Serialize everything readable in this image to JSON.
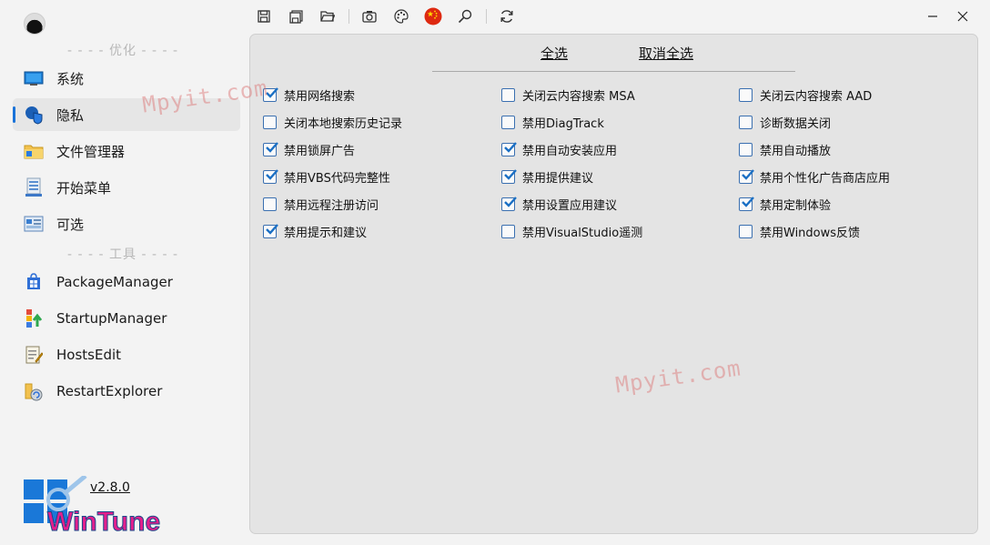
{
  "sidebar": {
    "section_optimize": "- - - - 优化 - - - -",
    "section_tools": "- - - - 工具 - - - -",
    "optimize_items": [
      {
        "label": "系统"
      },
      {
        "label": "隐私"
      },
      {
        "label": "文件管理器"
      },
      {
        "label": "开始菜单"
      },
      {
        "label": "可选"
      }
    ],
    "tool_items": [
      {
        "label": "PackageManager"
      },
      {
        "label": "StartupManager"
      },
      {
        "label": "HostsEdit"
      },
      {
        "label": "RestartExplorer"
      }
    ],
    "version": "v2.8.0",
    "logo_text": "WinTune"
  },
  "toolbar": {
    "icons": [
      "save-icon",
      "save-all-icon",
      "open-folder-icon",
      "screenshot-icon",
      "palette-icon",
      "china-flag-icon",
      "search-icon",
      "refresh-icon"
    ]
  },
  "panel": {
    "select_all": "全选",
    "deselect_all": "取消全选",
    "options": [
      {
        "label": "禁用网络搜索",
        "checked": true
      },
      {
        "label": "关闭本地搜索历史记录",
        "checked": false
      },
      {
        "label": "禁用锁屏广告",
        "checked": true
      },
      {
        "label": "禁用VBS代码完整性",
        "checked": true
      },
      {
        "label": "禁用远程注册访问",
        "checked": false
      },
      {
        "label": "禁用提示和建议",
        "checked": true
      },
      {
        "label": "关闭云内容搜索 MSA",
        "checked": false
      },
      {
        "label": "禁用DiagTrack",
        "checked": false
      },
      {
        "label": "禁用自动安装应用",
        "checked": true
      },
      {
        "label": "禁用提供建议",
        "checked": true
      },
      {
        "label": "禁用设置应用建议",
        "checked": true
      },
      {
        "label": "禁用VisualStudio遥测",
        "checked": false
      },
      {
        "label": "关闭云内容搜索 AAD",
        "checked": false
      },
      {
        "label": "诊断数据关闭",
        "checked": false
      },
      {
        "label": "禁用自动播放",
        "checked": false
      },
      {
        "label": "禁用个性化广告商店应用",
        "checked": true
      },
      {
        "label": "禁用定制体验",
        "checked": true
      },
      {
        "label": "禁用Windows反馈",
        "checked": false
      }
    ]
  },
  "watermark": "Mpyit.com",
  "colors": {
    "accent": "#1a73d9",
    "checkbox_border": "#3a6fb0",
    "panel_bg": "#e4e4e4"
  }
}
